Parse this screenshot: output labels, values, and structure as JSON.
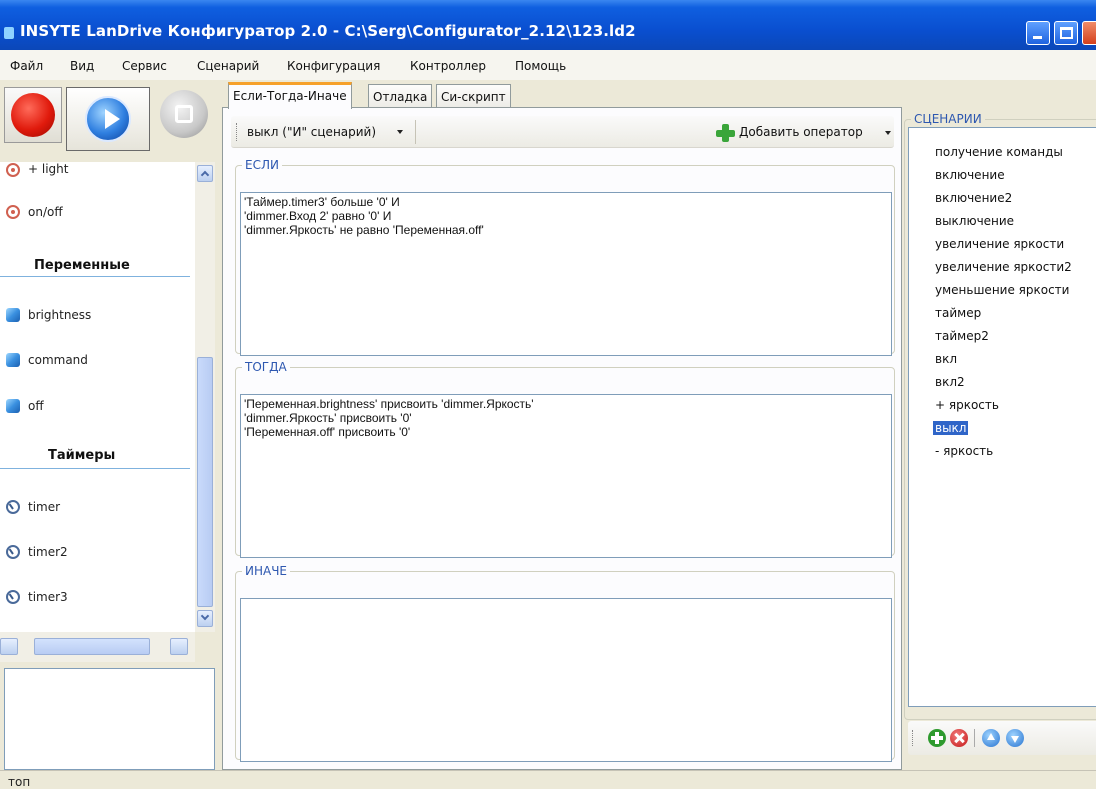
{
  "window": {
    "title": "INSYTE LanDrive Конфигуратор 2.0 - C:\\Serg\\Configurator_2.12\\123.ld2"
  },
  "menu": [
    "Файл",
    "Вид",
    "Сервис",
    "Сценарий",
    "Конфигурация",
    "Контроллер",
    "Помощь"
  ],
  "left_panel": {
    "devices": [
      {
        "label": "+ light",
        "icon": "antenna-icon"
      },
      {
        "label": "on/off",
        "icon": "antenna-icon"
      }
    ],
    "variables_header": "Переменные",
    "variables": [
      {
        "label": "brightness",
        "icon": "cube-icon"
      },
      {
        "label": "command",
        "icon": "cube-icon"
      },
      {
        "label": "off",
        "icon": "cube-icon"
      }
    ],
    "timers_header": "Таймеры",
    "timers": [
      {
        "label": "timer",
        "icon": "clock-icon"
      },
      {
        "label": "timer2",
        "icon": "clock-icon"
      },
      {
        "label": "timer3",
        "icon": "clock-icon"
      }
    ]
  },
  "tabs": [
    "Если-Тогда-Иначе",
    "Отладка",
    "Си-скрипт"
  ],
  "active_tab": 0,
  "toolbar": {
    "mode_label": "выкл (\"И\" сценарий)",
    "add_operator_label": "Добавить оператор"
  },
  "sections": {
    "if_title": "ЕСЛИ",
    "if_lines": [
      "'Таймер.timer3' больше '0' И",
      "'dimmer.Вход 2' равно '0' И",
      "'dimmer.Яркость' не равно 'Переменная.off'"
    ],
    "then_title": "ТОГДА",
    "then_lines": [
      "'Переменная.brightness' присвоить 'dimmer.Яркость'",
      "'dimmer.Яркость' присвоить '0'",
      "'Переменная.off' присвоить '0'"
    ],
    "else_title": "ИНАЧЕ",
    "else_lines": []
  },
  "scenarios": {
    "title": "СЦЕНАРИИ",
    "items": [
      "получение команды",
      "включение",
      "включение2",
      "выключение",
      "увеличение яркости",
      "увеличение яркости2",
      "уменьшение яркости",
      "таймер",
      "таймер2",
      "вкл",
      "вкл2",
      "+ яркость",
      "выкл",
      "- яркость"
    ],
    "selected_index": 12
  },
  "status": "топ",
  "colors": {
    "titlebar": "#0a4fd0",
    "group_title": "#2e58b0",
    "selection": "#2f65c8",
    "active_tab_accent": "#f6a12b"
  }
}
